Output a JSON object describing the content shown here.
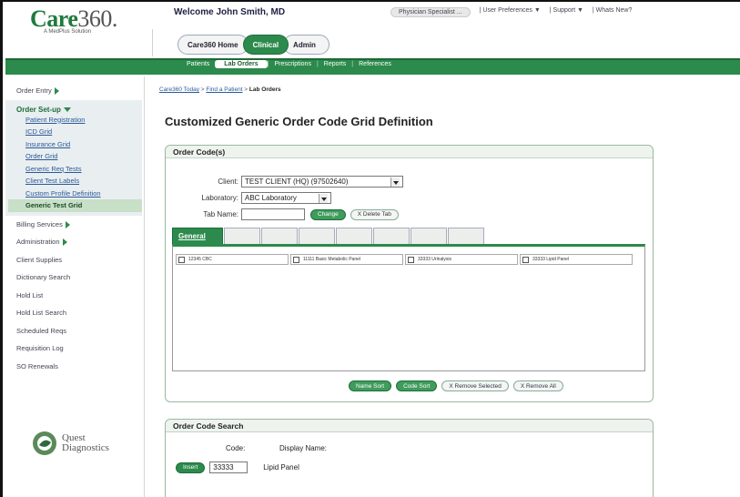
{
  "header": {
    "logo_word": "Care",
    "logo_num": "360.",
    "logo_sub": "A MedPlus Solution",
    "welcome": "Welcome John Smith, MD",
    "top_nav": [
      "Physician Specialist ...",
      "| User Preferences ▼",
      "| Support ▼",
      "| Whats New?"
    ]
  },
  "main_tabs": [
    "Care360 Home",
    "Clinical",
    "Admin"
  ],
  "sub_nav": [
    "Patients",
    "Lab Orders",
    "Prescriptions",
    "Reports",
    "References"
  ],
  "sidebar": {
    "order_entry": "Order Entry",
    "order_setup": "Order Set-up",
    "setup_links": [
      "Patient Registration",
      "ICD Grid",
      "Insurance Grid",
      "Order Grid",
      "Generic Req Tests",
      "Client Test Labels",
      "Custom Profile Definition",
      "Generic Test Grid"
    ],
    "sections": [
      "Billing Services",
      "Administration",
      "Client Supplies",
      "Dictionary Search",
      "Hold List",
      "Hold List Search",
      "Scheduled Reqs",
      "Requisition Log",
      "SO Renewals"
    ],
    "quest_line1": "Quest",
    "quest_line2": "Diagnostics"
  },
  "breadcrumb": {
    "home": "Care360 Today",
    "find": "Find a Patient",
    "current": "Lab Orders",
    "sep": " > "
  },
  "page_title": "Customized Generic Order Code Grid Definition",
  "order_codes": {
    "title": "Order Code(s)",
    "client_label": "Client:",
    "client_value": "TEST CLIENT (HQ) (97502640)",
    "lab_label": "Laboratory:",
    "lab_value": "ABC Laboratory",
    "tab_label": "Tab Name:",
    "tab_value": "",
    "change_btn": "Change",
    "delete_tab_btn": "X Delete Tab",
    "general_tab": "General",
    "grid_items": [
      "12345 CBC",
      "11111 Basic Metabolic Panel",
      "33333 Urinalysis",
      "33333 Lipid Panel"
    ],
    "name_sort": "Name Sort",
    "code_sort": "Code Sort",
    "remove_selected": "X Remove Selected",
    "remove_all": "X Remove All"
  },
  "order_code_search": {
    "title": "Order Code Search",
    "code_label": "Code:",
    "display_label": "Display Name:",
    "insert_btn": "Insert",
    "code_value": "33333",
    "display_value": "Lipid Panel"
  },
  "colors": {
    "brand_green": "#2c8a4c",
    "link_blue": "#2a5a9a"
  }
}
